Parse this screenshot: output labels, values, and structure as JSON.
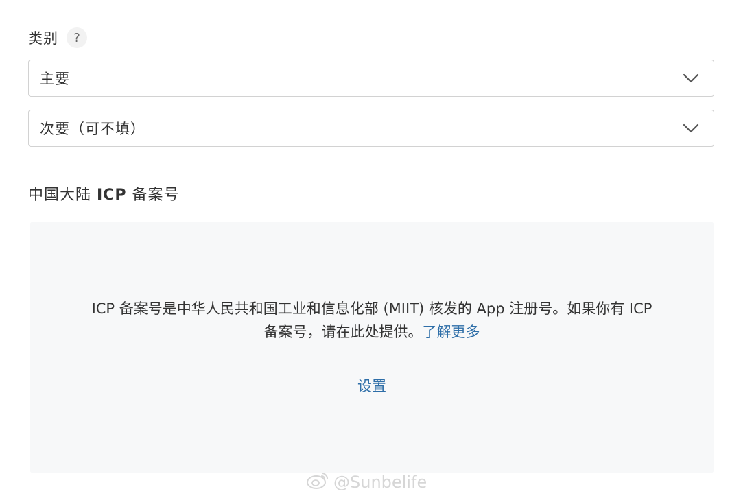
{
  "category": {
    "label": "类别",
    "help_glyph": "?"
  },
  "primary_select": {
    "value": "主要"
  },
  "secondary_select": {
    "value": "次要（可不填）"
  },
  "icp": {
    "title_prefix": "中国大陆 ",
    "title_bold": "ICP",
    "title_suffix": " 备案号",
    "description_line1": "ICP 备案号是中华人民共和国工业和信息化部 (MIIT) 核发的 App 注册号。如果你有 ICP",
    "description_line2": "备案号，请在此处提供。",
    "learn_more": "了解更多",
    "setup": "设置"
  },
  "watermark": {
    "text": "@Sunbelife",
    "icon": "weibo-icon"
  },
  "colors": {
    "link": "#2e6ea8",
    "panel_bg": "#f7f8f9",
    "border": "#d2d2d2"
  }
}
